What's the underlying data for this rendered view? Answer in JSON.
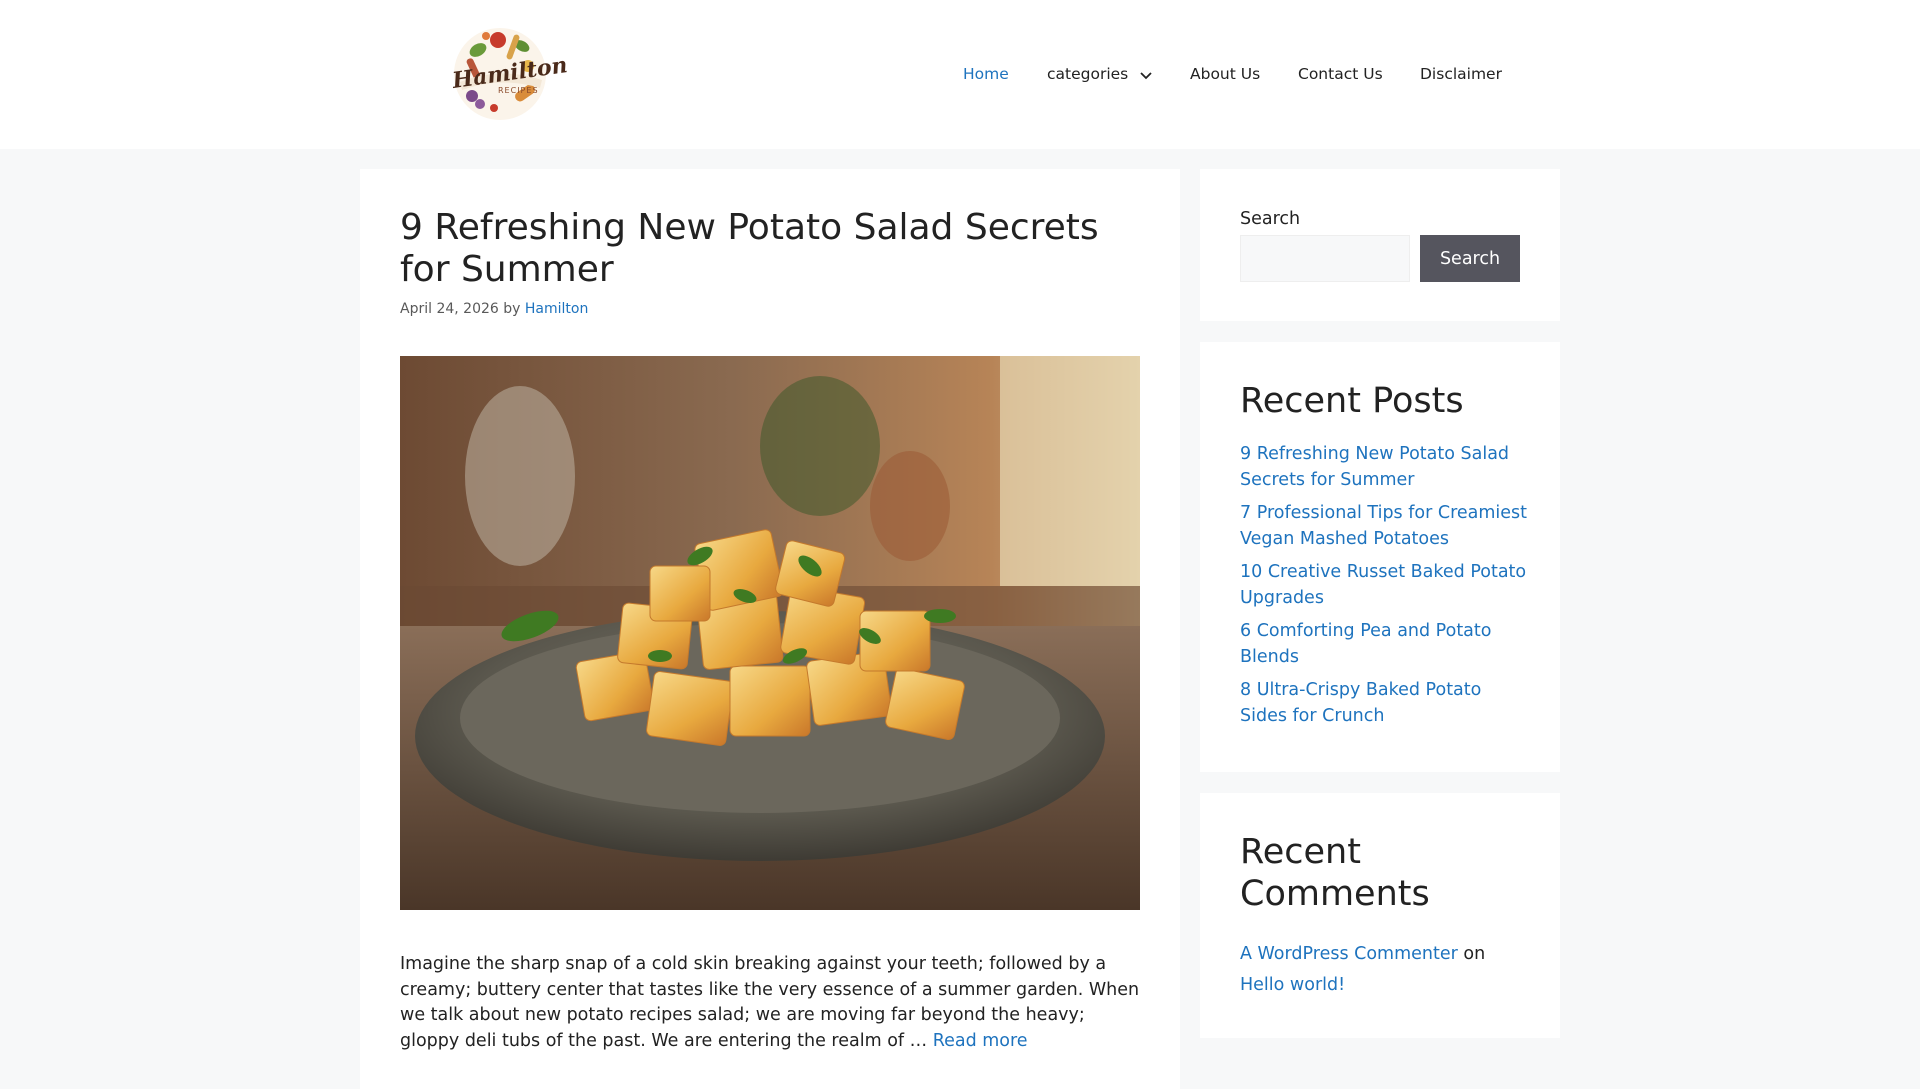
{
  "header": {
    "logo_text": "Hamilton",
    "logo_subtext": "RECIPES",
    "nav": [
      {
        "label": "Home",
        "active": true
      },
      {
        "label": "categories",
        "has_dropdown": true
      },
      {
        "label": "About Us"
      },
      {
        "label": "Contact Us"
      },
      {
        "label": "Disclaimer"
      }
    ]
  },
  "article": {
    "title": "9 Refreshing New Potato Salad Secrets for Summer",
    "date": "April 24, 2026",
    "by": "by",
    "author": "Hamilton",
    "image_alt": "Roasted potato cubes with herbs in a ceramic bowl",
    "excerpt": "Imagine the sharp snap of a cold skin breaking against your teeth; followed by a creamy; buttery center that tastes like the very essence of a summer garden. When we talk about new potato recipes salad; we are moving far beyond the heavy; gloppy deli tubs of the past. We are entering the realm of … ",
    "read_more": "Read more"
  },
  "sidebar": {
    "search": {
      "label": "Search",
      "placeholder": "",
      "button_label": "Search"
    },
    "recent_posts": {
      "title": "Recent Posts",
      "items": [
        "9 Refreshing New Potato Salad Secrets for Summer",
        "7 Professional Tips for Creamiest Vegan Mashed Potatoes",
        "10 Creative Russet Baked Potato Upgrades",
        "6 Comforting Pea and Potato Blends",
        "8 Ultra-Crispy Baked Potato Sides for Crunch"
      ]
    },
    "recent_comments": {
      "title": "Recent Comments",
      "commenter": "A WordPress Commenter",
      "on": " on ",
      "post": "Hello world!"
    }
  },
  "colors": {
    "accent": "#1e73be",
    "background": "#f7f8f9",
    "button": "#55555e",
    "text": "#222222"
  }
}
